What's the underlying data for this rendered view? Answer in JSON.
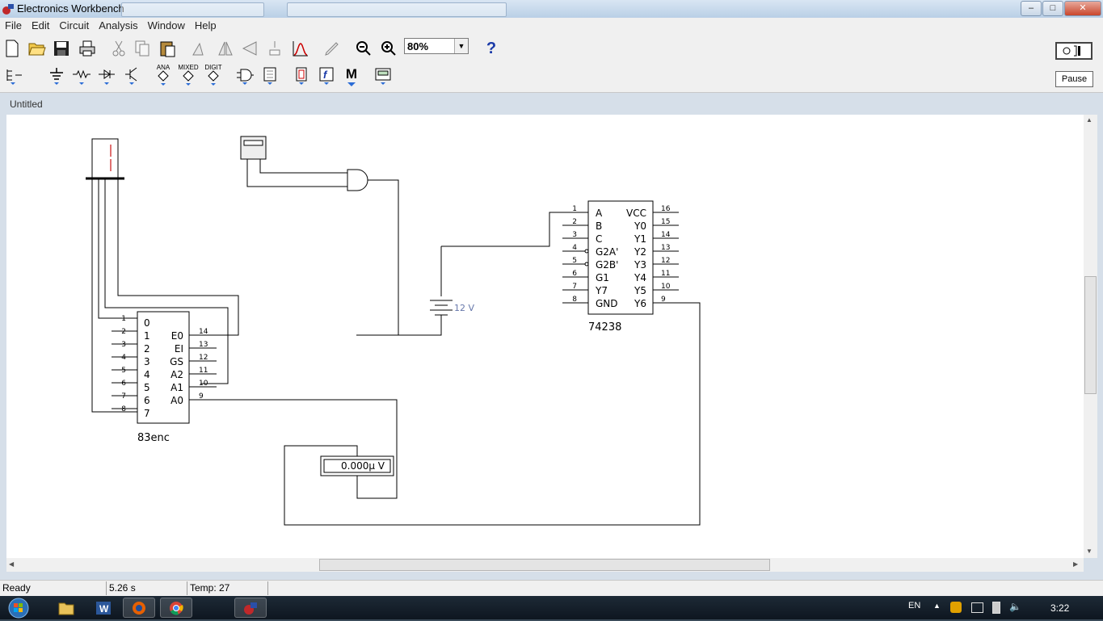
{
  "window": {
    "title": "Electronics Workbench",
    "controls": {
      "minimize": "–",
      "maximize": "□",
      "close": "✕"
    }
  },
  "menu": [
    "File",
    "Edit",
    "Circuit",
    "Analysis",
    "Window",
    "Help"
  ],
  "toolbar": {
    "zoom_value": "80%",
    "help_label": "?",
    "parts_labels": {
      "analog": "ANA",
      "mixed": "MIXED",
      "digital": "DIGIT",
      "misc": "M"
    },
    "pause_label": "Pause"
  },
  "document": {
    "title": "Untitled"
  },
  "schematic": {
    "encoder": {
      "name": "83enc",
      "left_pin_numbers": [
        "1",
        "2",
        "3",
        "4",
        "5",
        "6",
        "7",
        "8"
      ],
      "left_pin_labels": [
        "0",
        "1",
        "2",
        "3",
        "4",
        "5",
        "6",
        "7"
      ],
      "right_pin_numbers": [
        "14",
        "13",
        "12",
        "11",
        "10",
        "9"
      ],
      "right_pin_labels": [
        "E0",
        "EI",
        "GS",
        "A2",
        "A1",
        "A0"
      ]
    },
    "decoder": {
      "name": "74238",
      "left_pin_numbers": [
        "1",
        "2",
        "3",
        "4",
        "5",
        "6",
        "7",
        "8"
      ],
      "left_pin_labels": [
        "A",
        "B",
        "C",
        "G2A'",
        "G2B'",
        "G1",
        "Y7",
        "GND"
      ],
      "right_pin_numbers": [
        "16",
        "15",
        "14",
        "13",
        "12",
        "11",
        "10",
        "9"
      ],
      "right_pin_labels": [
        "VCC",
        "Y0",
        "Y1",
        "Y2",
        "Y3",
        "Y4",
        "Y5",
        "Y6"
      ]
    },
    "battery_label": "12 V",
    "voltmeter_reading": "0.000µ V"
  },
  "status": {
    "state": "Ready",
    "time": "5.26 s",
    "temp": "Temp:  27"
  },
  "taskbar": {
    "language": "EN",
    "clock": "3:22"
  },
  "colors": {
    "titlebar": "#c9dbee",
    "canvas": "#ffffff",
    "display_segment": "#e07070",
    "battery_label": "#6677aa"
  }
}
